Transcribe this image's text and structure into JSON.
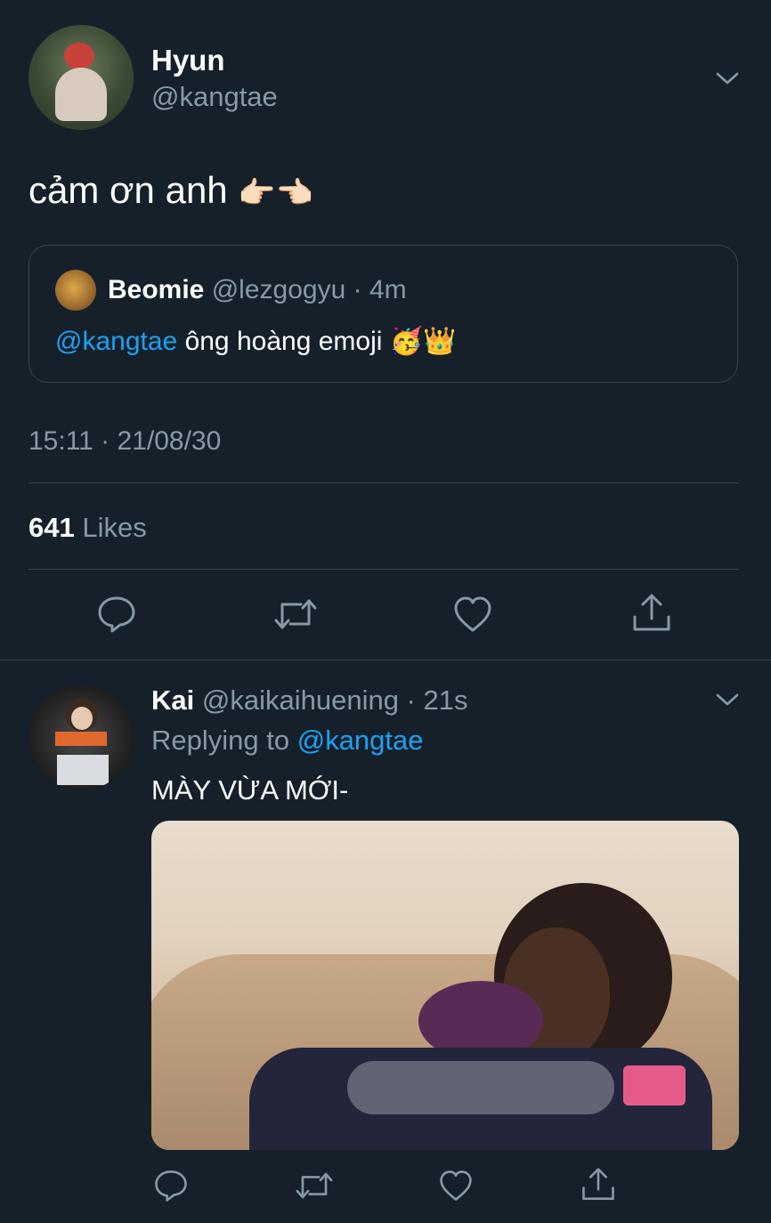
{
  "main_tweet": {
    "author_name": "Hyun",
    "author_handle": "@kangtae",
    "text": "cảm ơn anh",
    "text_emoji": "👉🏻👈🏻",
    "quoted": {
      "author_name": "Beomie",
      "author_handle": "@lezgogyu",
      "time": "4m",
      "mention": "@kangtae",
      "text": "ông hoàng emoji",
      "emoji": "🥳👑"
    },
    "timestamp": "15:11 · 21/08/30",
    "likes_count": "641",
    "likes_label": "Likes"
  },
  "reply": {
    "author_name": "Kai",
    "author_handle": "@kaikaihuening",
    "time": "21s",
    "replying_to_label": "Replying to",
    "replying_to_handle": "@kangtae",
    "text": "MÀY VỪA MỚI-"
  },
  "icons": {
    "reply": "reply-icon",
    "retweet": "retweet-icon",
    "like": "heart-icon",
    "share": "share-icon",
    "more": "chevron-down-icon"
  },
  "colors": {
    "background": "#15202b",
    "text": "#ffffff",
    "muted": "#8899a6",
    "link": "#1da1f2",
    "divider": "#38444d"
  }
}
